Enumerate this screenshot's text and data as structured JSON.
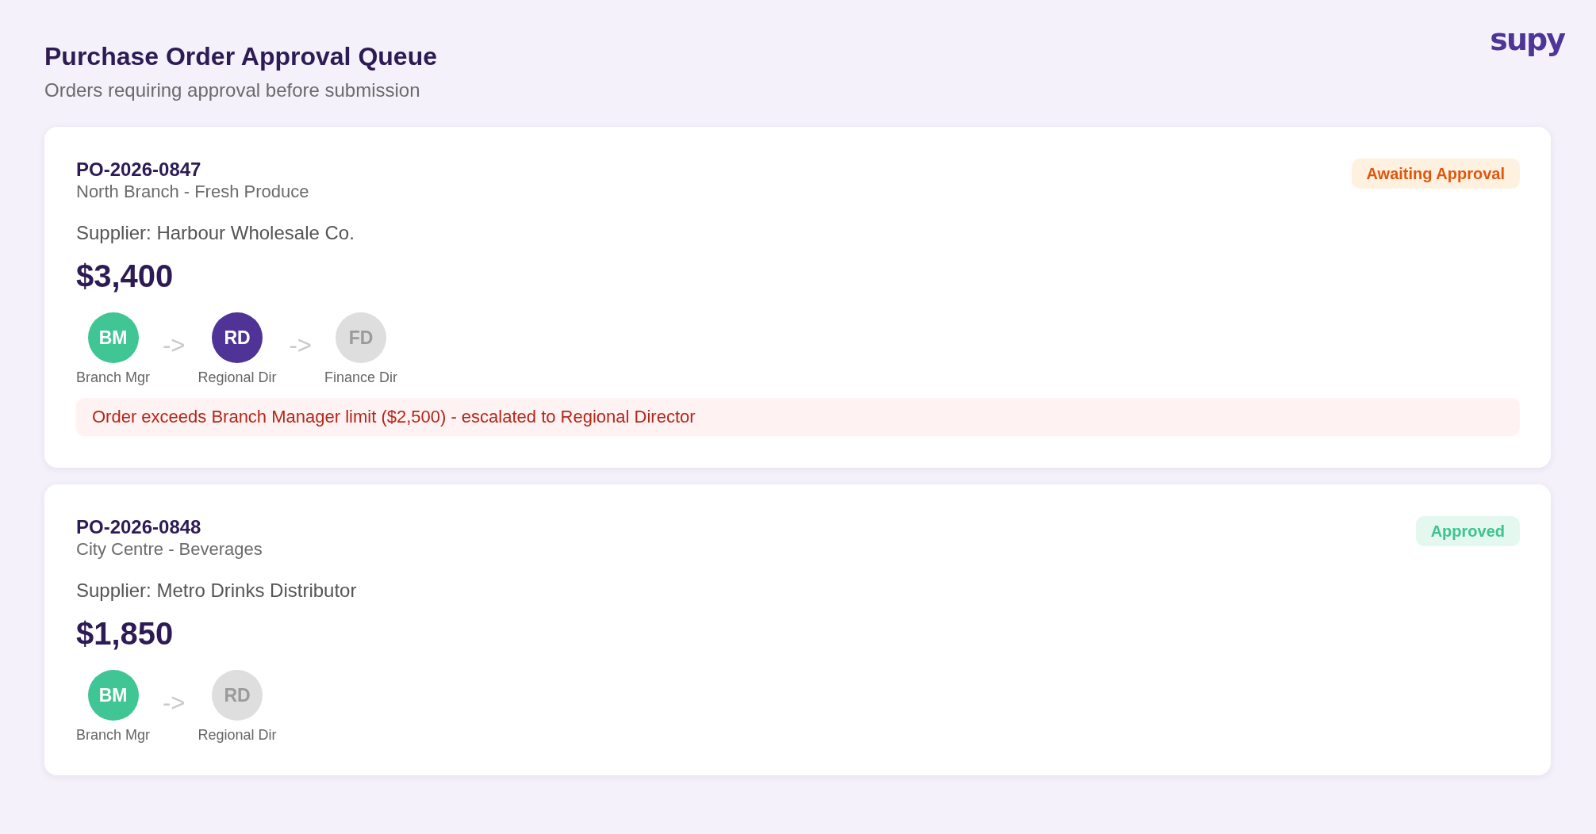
{
  "header": {
    "title": "Purchase Order Approval Queue",
    "subtitle": "Orders requiring approval before submission",
    "logo": "supy"
  },
  "orders": [
    {
      "id": "PO-2026-0847",
      "location": "North Branch - Fresh Produce",
      "status": {
        "kind": "awaiting",
        "label": "Awaiting Approval"
      },
      "supplier": "Supplier: Harbour Wholesale Co.",
      "amount": "$3,400",
      "flow": [
        {
          "kind": "step",
          "initials": "BM",
          "role": "Branch Mgr",
          "approved": true,
          "active": false
        },
        {
          "kind": "arrow",
          "text": "->"
        },
        {
          "kind": "step",
          "initials": "RD",
          "role": "Regional Dir",
          "approved": false,
          "active": true
        },
        {
          "kind": "arrow",
          "text": "->"
        },
        {
          "kind": "step",
          "initials": "FD",
          "role": "Finance Dir",
          "approved": false,
          "active": false
        }
      ],
      "alert": "Order exceeds Branch Manager limit ($2,500) - escalated to Regional Director"
    },
    {
      "id": "PO-2026-0848",
      "location": "City Centre - Beverages",
      "status": {
        "kind": "approved",
        "label": "Approved"
      },
      "supplier": "Supplier: Metro Drinks Distributor",
      "amount": "$1,850",
      "flow": [
        {
          "kind": "step",
          "initials": "BM",
          "role": "Branch Mgr",
          "approved": true,
          "active": false
        },
        {
          "kind": "arrow",
          "text": "->"
        },
        {
          "kind": "step",
          "initials": "RD",
          "role": "Regional Dir",
          "approved": false,
          "active": false
        }
      ]
    }
  ]
}
